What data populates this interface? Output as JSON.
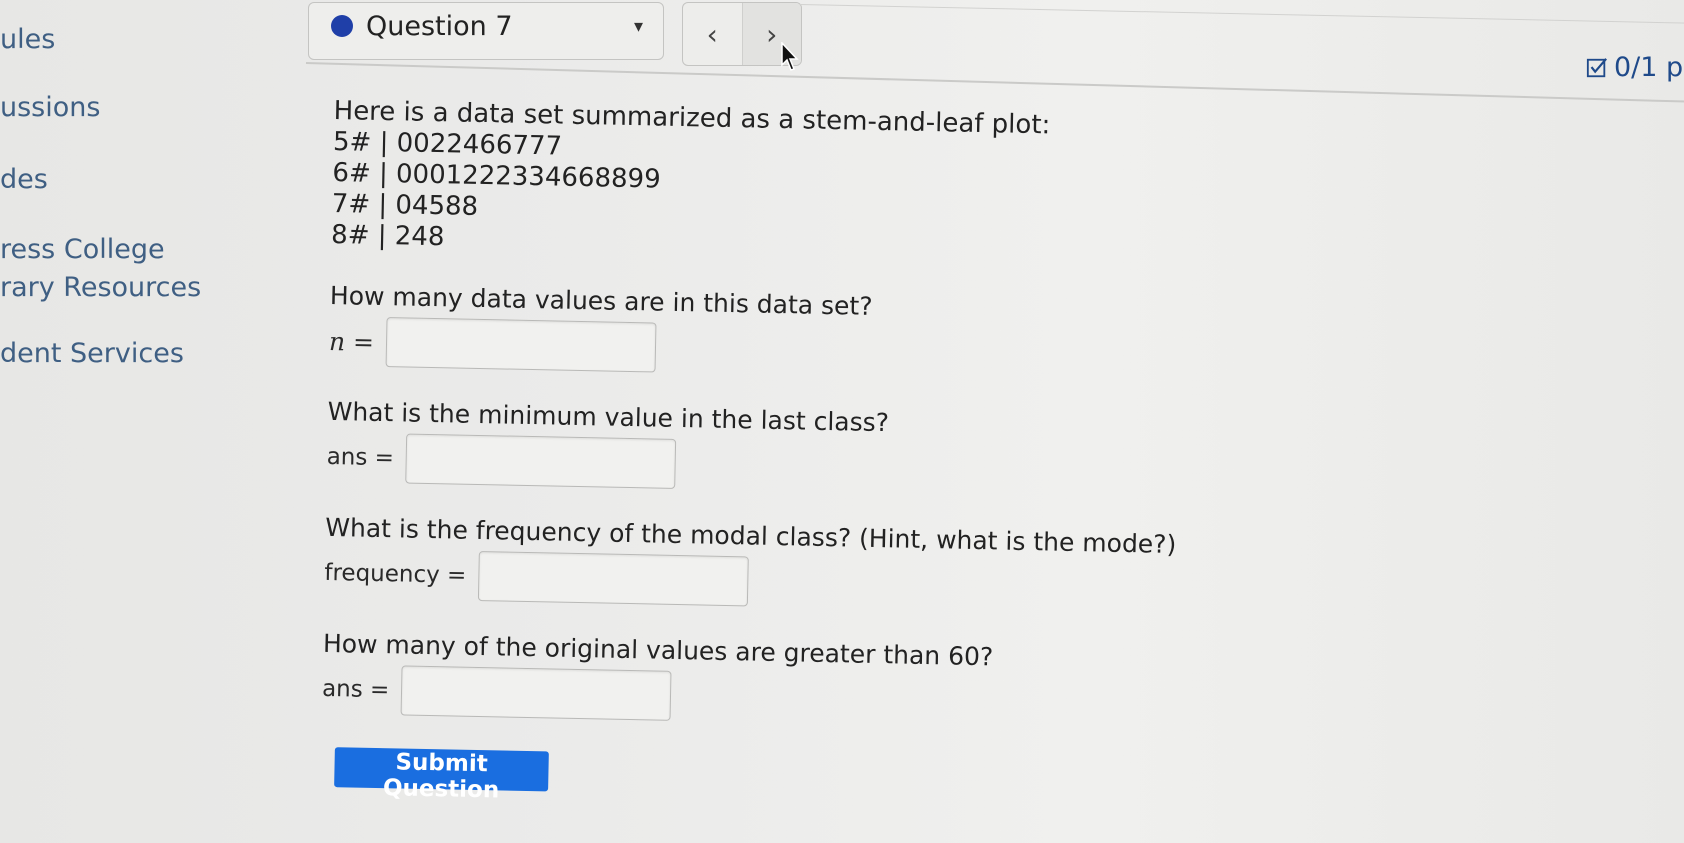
{
  "sidebar": {
    "items": [
      {
        "label": "ules"
      },
      {
        "label": "ussions"
      },
      {
        "label": "des"
      },
      {
        "label": "ress College"
      },
      {
        "label": "rary Resources"
      },
      {
        "label": "dent Services"
      }
    ]
  },
  "header": {
    "question_label": "Question 7",
    "caret": "▾",
    "prev": "‹",
    "next": "›",
    "points": "0/1 p"
  },
  "question": {
    "intro": "Here is a data set summarized as a stem-and-leaf plot:",
    "stem_leaf": [
      "5# | 0022466777",
      "6# | 0001222334668899",
      "7# | 04588",
      "8# | 248"
    ],
    "parts": [
      {
        "prompt": "How many data values are in this data set?",
        "label": "n =",
        "value": ""
      },
      {
        "prompt": "What is the minimum value in the last class?",
        "label": "ans =",
        "value": ""
      },
      {
        "prompt": "What is the frequency of the modal class? (Hint, what is the mode?)",
        "label": "frequency =",
        "value": ""
      },
      {
        "prompt": "How many of the original values are greater than 60?",
        "label": "ans =",
        "value": ""
      }
    ],
    "submit_label": "Submit Question"
  },
  "colors": {
    "accent": "#1a6ee0",
    "status_dot": "#1f3fa8",
    "sidebar_link": "#3f5f83"
  }
}
